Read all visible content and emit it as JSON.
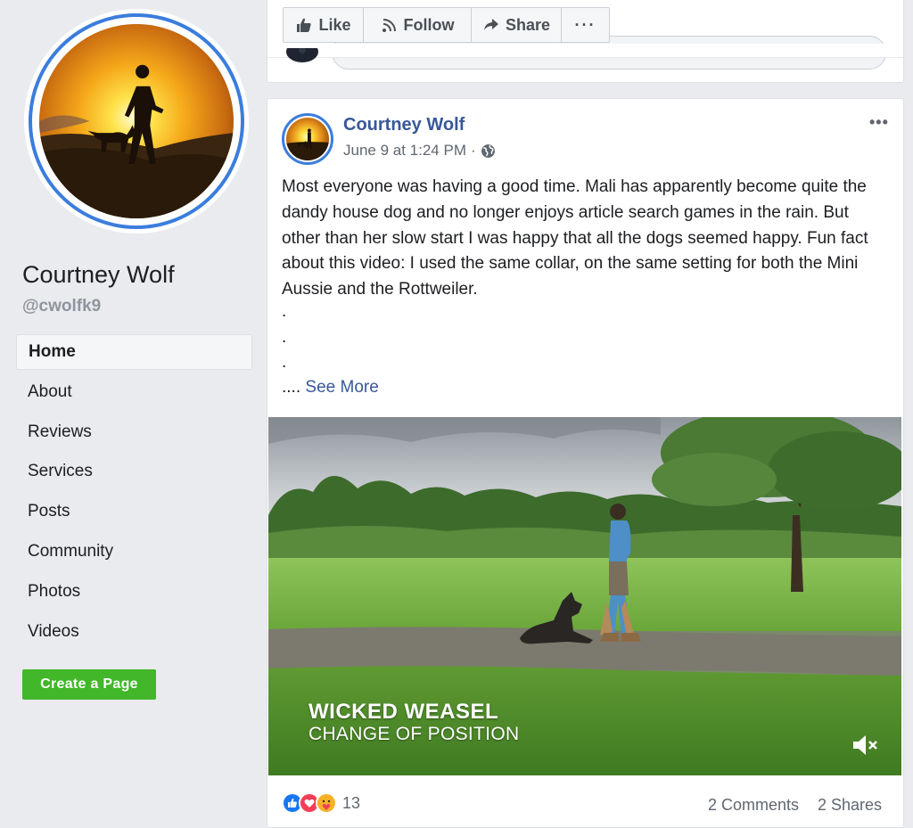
{
  "page": {
    "name": "Courtney Wolf",
    "handle": "@cwolfk9"
  },
  "nav": {
    "items": [
      {
        "label": "Home",
        "active": true
      },
      {
        "label": "About"
      },
      {
        "label": "Reviews"
      },
      {
        "label": "Services"
      },
      {
        "label": "Posts"
      },
      {
        "label": "Community"
      },
      {
        "label": "Photos"
      },
      {
        "label": "Videos"
      }
    ]
  },
  "create_page": {
    "label": "Create a Page",
    "color": "#42b72a"
  },
  "actions": {
    "like": "Like",
    "follow": "Follow",
    "share": "Share",
    "more": "···"
  },
  "post": {
    "author": "Courtney Wolf",
    "date": "June 9 at 1:24 PM",
    "separator": "·",
    "options": "•••",
    "text": "Most everyone was having a good time. Mali has apparently become quite the dandy house dog and no longer enjoys article search games in the rain. But other than her slow start I was happy that all the dogs seemed happy. Fun fact about this video: I used the same collar, on the same setting for both the Mini Aussie and the Rottweiler.",
    "dots": [
      ".",
      ".",
      "."
    ],
    "ellipsis": "....",
    "see_more": "See More",
    "video": {
      "title": "WICKED WEASEL",
      "subtitle": "CHANGE OF POSITION"
    },
    "reactions": {
      "icons": [
        "like-icon",
        "love-icon",
        "care-icon"
      ],
      "count": "13"
    },
    "comments": "2 Comments",
    "shares": "2 Shares"
  },
  "colors": {
    "accent": "#385898",
    "ring": "#3b7ddd",
    "background": "#e9ebee"
  }
}
